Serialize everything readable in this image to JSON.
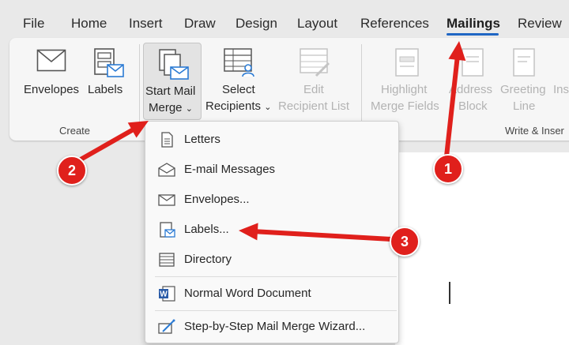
{
  "tabs": [
    "File",
    "Home",
    "Insert",
    "Draw",
    "Design",
    "Layout",
    "References",
    "Mailings",
    "Review"
  ],
  "ribbon": {
    "envelopes_label": "Envelopes",
    "labels_label": "Labels",
    "start_mail_merge_line1": "Start Mail",
    "start_mail_merge_line2": "Merge",
    "select_recipients_line1": "Select",
    "select_recipients_line2": "Recipients",
    "edit_recipient_line1": "Edit",
    "edit_recipient_line2": "Recipient List",
    "highlight_line1": "Highlight",
    "highlight_line2": "Merge Fields",
    "address_line1": "Address",
    "address_line2": "Block",
    "greeting_line1": "Greeting",
    "greeting_line2": "Line",
    "insert_partial": "Ins",
    "chevron": "⌄",
    "group_create": "Create",
    "group_write_insert": "Write & Inser"
  },
  "menu": {
    "items": [
      {
        "label": "Letters"
      },
      {
        "label": "E-mail Messages"
      },
      {
        "label": "Envelopes..."
      },
      {
        "label": "Labels..."
      },
      {
        "label": "Directory"
      },
      {
        "label": "Normal Word Document"
      },
      {
        "label": "Step-by-Step Mail Merge Wizard..."
      }
    ]
  },
  "annotations": {
    "badge1": "1",
    "badge2": "2",
    "badge3": "3",
    "arrow_color": "#e0201c"
  },
  "colors": {
    "accent": "#1f66c4",
    "disabled_text": "#b3b3b3"
  }
}
